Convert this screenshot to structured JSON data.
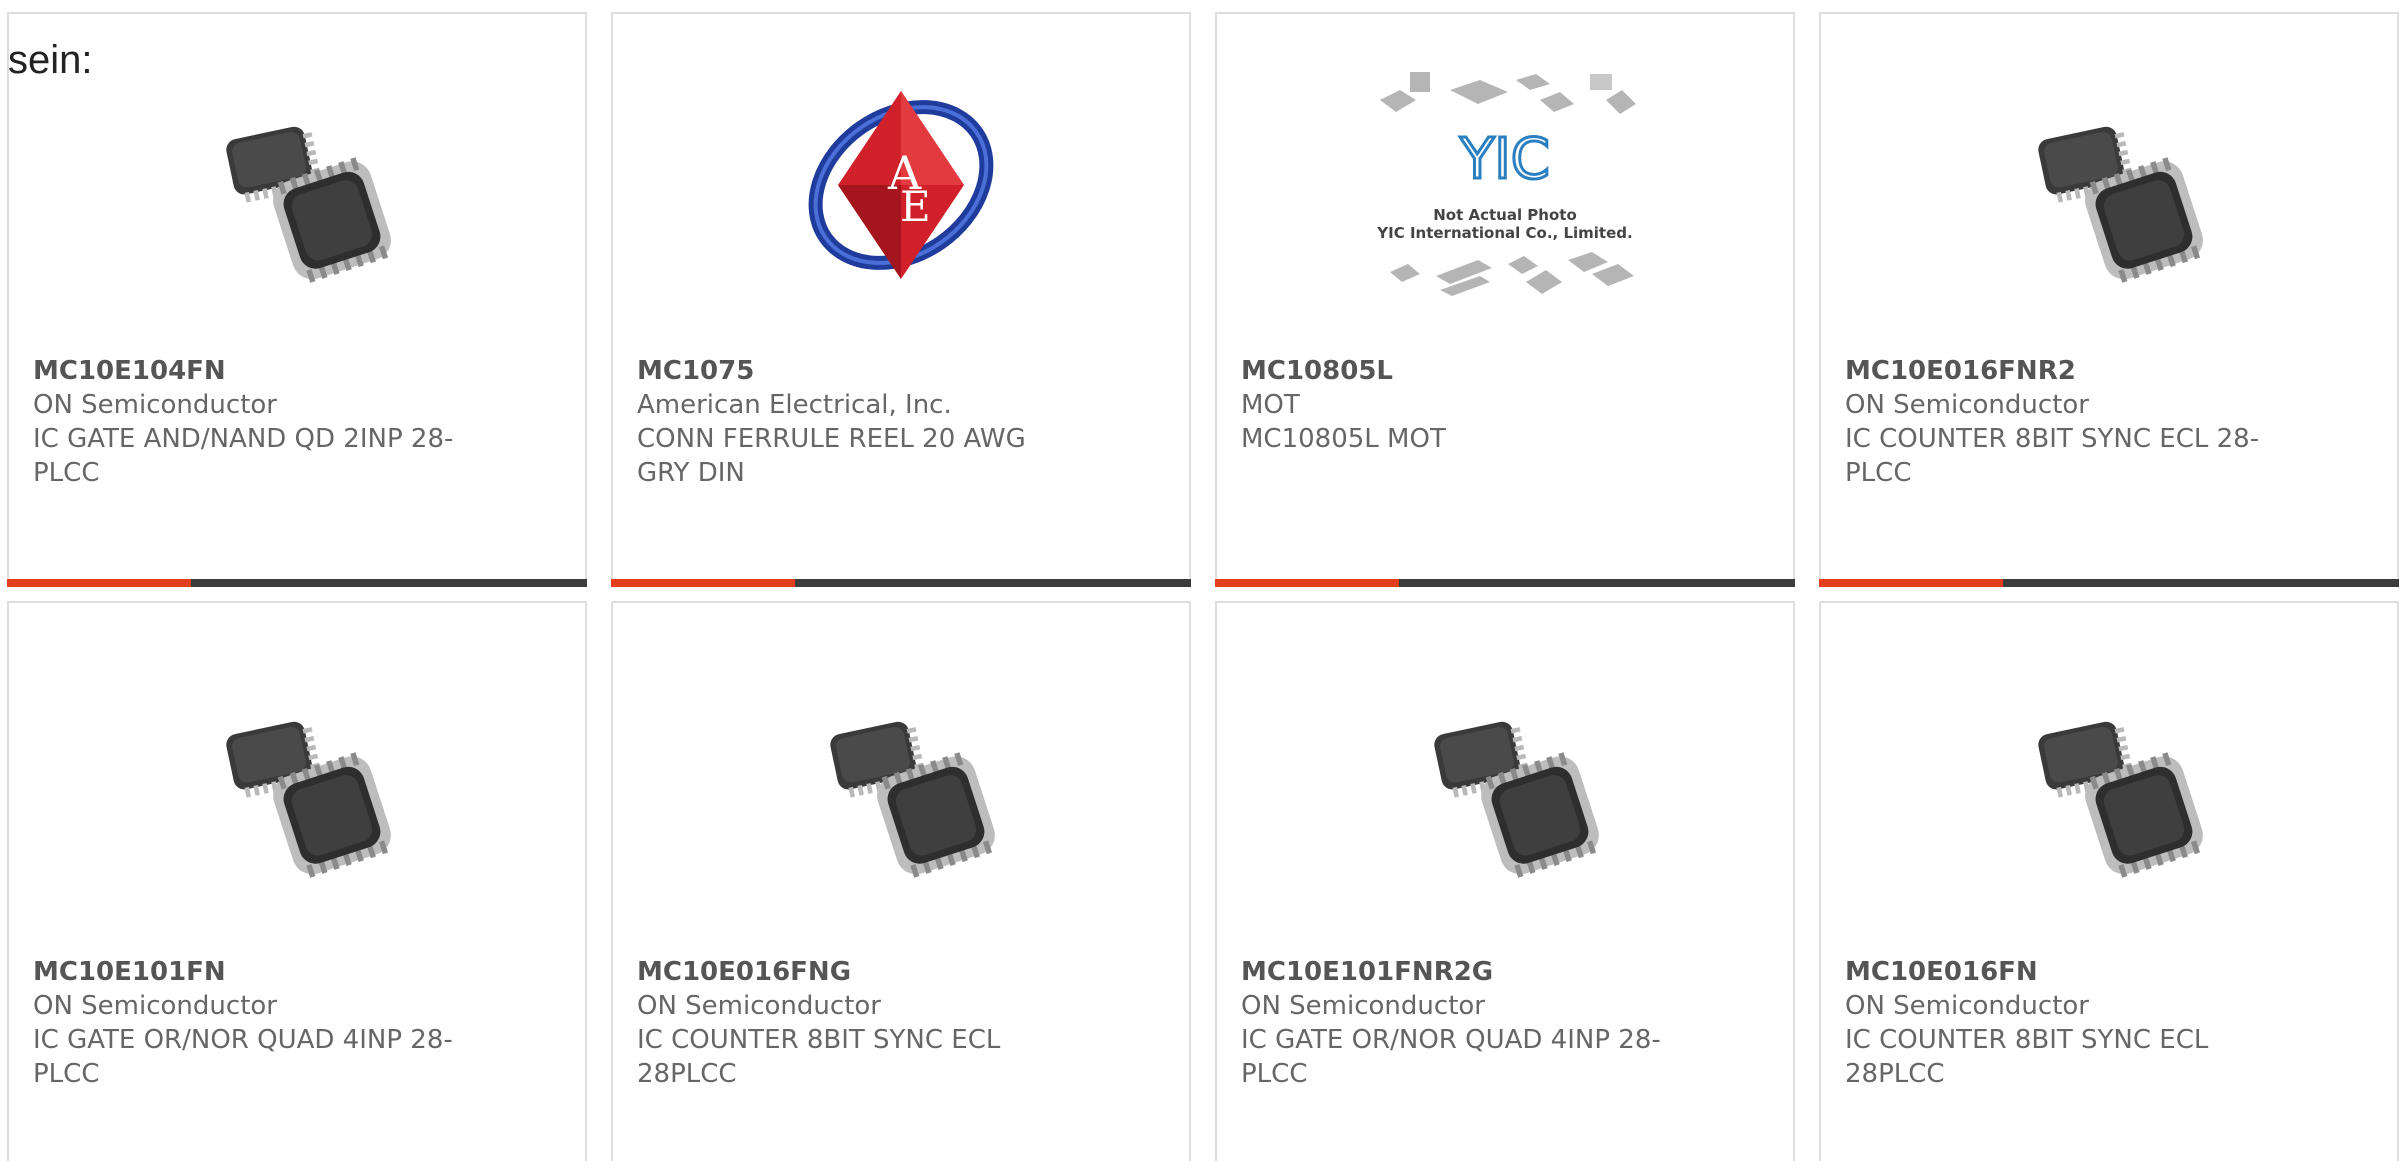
{
  "intro": "sein:",
  "colors": {
    "accent": "#e2401c",
    "bar": "#3b3b3b",
    "border": "#dedede",
    "text": "#666666"
  },
  "products": [
    {
      "part": "MC10E104FN",
      "maker": "ON Semiconductor",
      "desc": "IC GATE AND/NAND QD 2INP 28-PLCC",
      "image": "plcc-chip-icon",
      "bar": true
    },
    {
      "part": "MC1075",
      "maker": "American Electrical, Inc.",
      "desc": "CONN FERRULE REEL 20 AWG GRY DIN",
      "image": "ae-logo",
      "bar": true
    },
    {
      "part": "MC10805L",
      "maker": "MOT",
      "desc": "MC10805L MOT",
      "image": "yic-placeholder-logo",
      "bar": true,
      "logo_text": [
        "YIC",
        "Not Actual Photo",
        "YIC International Co., Limited."
      ]
    },
    {
      "part": "MC10E016FNR2",
      "maker": "ON Semiconductor",
      "desc": "IC COUNTER 8BIT SYNC ECL 28-PLCC",
      "image": "plcc-chip-icon",
      "bar": true
    },
    {
      "part": "MC10E101FN",
      "maker": "ON Semiconductor",
      "desc": "IC GATE OR/NOR QUAD 4INP 28-PLCC",
      "image": "plcc-chip-icon",
      "bar": false
    },
    {
      "part": "MC10E016FNG",
      "maker": "ON Semiconductor",
      "desc": "IC COUNTER 8BIT SYNC ECL 28PLCC",
      "image": "plcc-chip-icon",
      "bar": false
    },
    {
      "part": "MC10E101FNR2G",
      "maker": "ON Semiconductor",
      "desc": "IC GATE OR/NOR QUAD 4INP 28-PLCC",
      "image": "plcc-chip-icon",
      "bar": false
    },
    {
      "part": "MC10E016FN",
      "maker": "ON Semiconductor",
      "desc": "IC COUNTER 8BIT SYNC ECL 28PLCC",
      "image": "plcc-chip-icon",
      "bar": false
    }
  ]
}
